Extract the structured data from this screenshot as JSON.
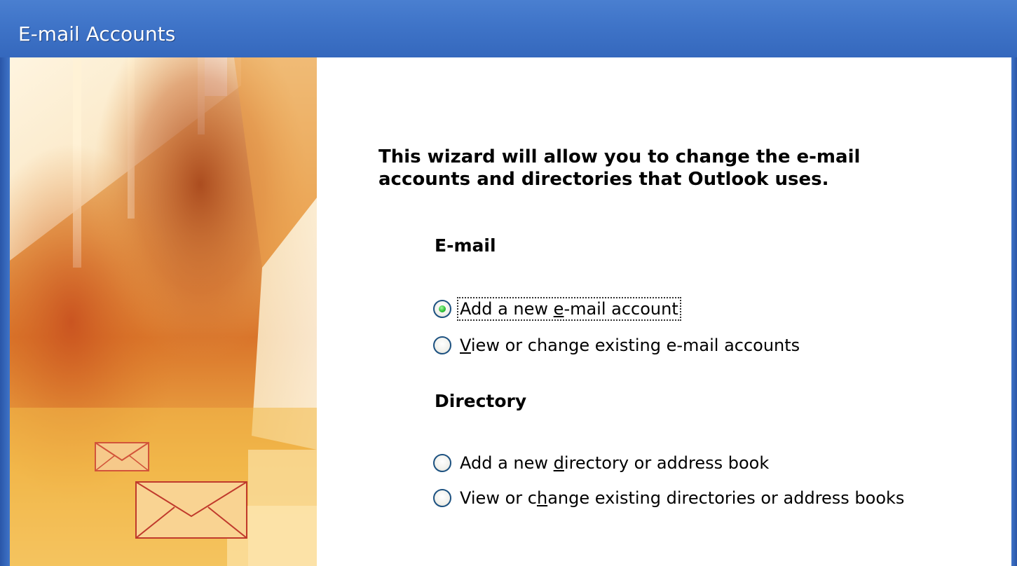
{
  "window": {
    "title": "E-mail Accounts"
  },
  "wizard": {
    "intro": "This wizard will allow you to change the e-mail accounts and directories that Outlook uses.",
    "email_section": {
      "heading": "E-mail",
      "options": [
        {
          "pre": "Add a new ",
          "mnemonic": "e",
          "post": "-mail account",
          "selected": true
        },
        {
          "pre": "",
          "mnemonic": "V",
          "post": "iew or change existing e-mail accounts",
          "selected": false
        }
      ]
    },
    "directory_section": {
      "heading": "Directory",
      "options": [
        {
          "pre": "Add a new ",
          "mnemonic": "d",
          "post": "irectory or address book",
          "selected": false
        },
        {
          "pre": "View or c",
          "mnemonic": "h",
          "post": "ange existing directories or address books",
          "selected": false
        }
      ]
    }
  },
  "icons": {
    "side_art": "envelope-artwork",
    "radio_selected": "radio-checked-icon",
    "radio_unselected": "radio-unchecked-icon"
  },
  "colors": {
    "titlebar": "#3f74c8",
    "radio_dot": "#31c63a",
    "art_orange": "#e07a1c"
  }
}
